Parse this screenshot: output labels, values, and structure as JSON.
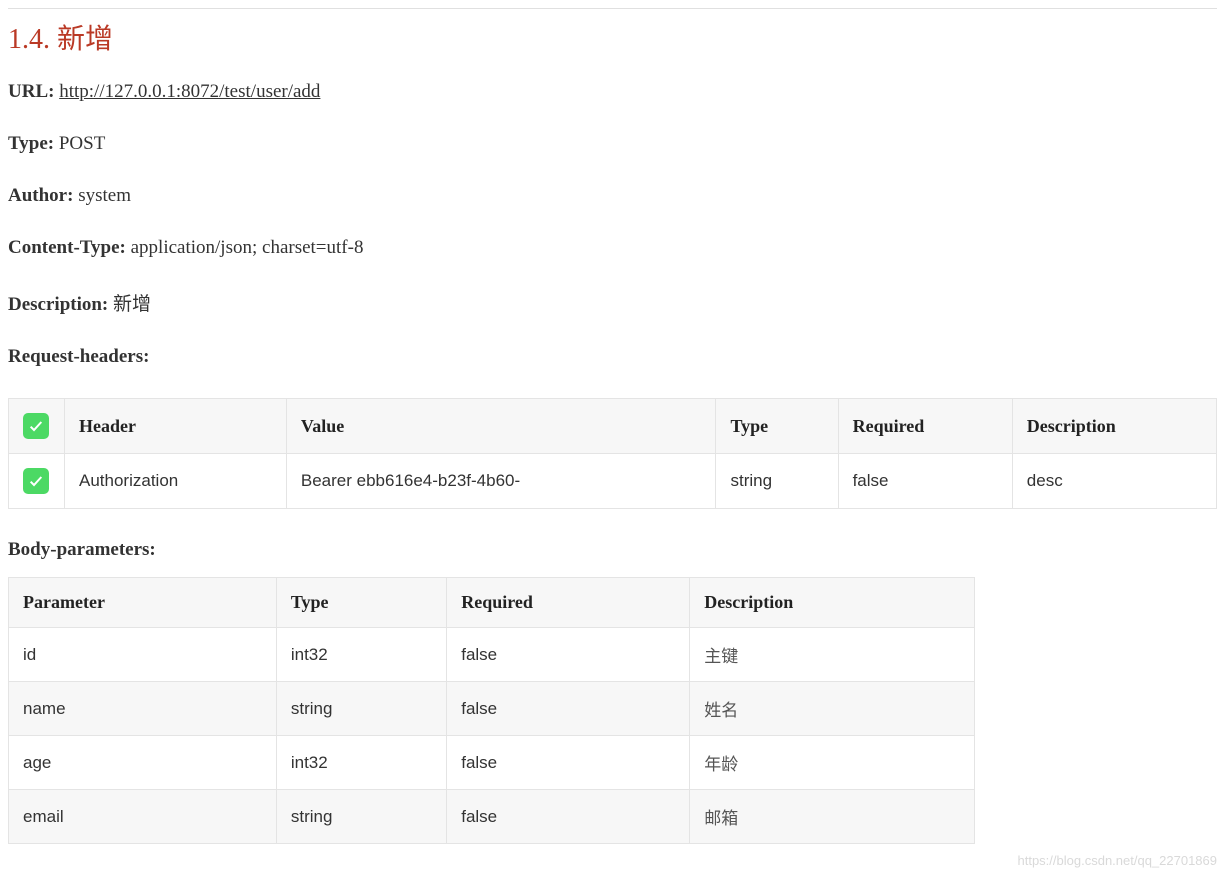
{
  "section": {
    "number": "1.4.",
    "title": "新增"
  },
  "meta": {
    "url_label": "URL:",
    "url_value": "http://127.0.0.1:8072/test/user/add",
    "type_label": "Type:",
    "type_value": "POST",
    "author_label": "Author:",
    "author_value": "system",
    "content_type_label": "Content-Type:",
    "content_type_value": "application/json; charset=utf-8",
    "description_label": "Description:",
    "description_value": "新增",
    "request_headers_label": "Request-headers:",
    "body_parameters_label": "Body-parameters:"
  },
  "request_headers": {
    "columns": {
      "header": "Header",
      "value": "Value",
      "type": "Type",
      "required": "Required",
      "description": "Description"
    },
    "rows": [
      {
        "header": "Authorization",
        "value": "Bearer ebb616e4-b23f-4b60-",
        "type": "string",
        "required": "false",
        "description": "desc"
      }
    ]
  },
  "body_parameters": {
    "columns": {
      "parameter": "Parameter",
      "type": "Type",
      "required": "Required",
      "description": "Description"
    },
    "rows": [
      {
        "parameter": "id",
        "type": "int32",
        "required": "false",
        "description": "主键"
      },
      {
        "parameter": "name",
        "type": "string",
        "required": "false",
        "description": "姓名"
      },
      {
        "parameter": "age",
        "type": "int32",
        "required": "false",
        "description": "年龄"
      },
      {
        "parameter": "email",
        "type": "string",
        "required": "false",
        "description": "邮箱"
      }
    ]
  },
  "watermark": "https://blog.csdn.net/qq_22701869"
}
